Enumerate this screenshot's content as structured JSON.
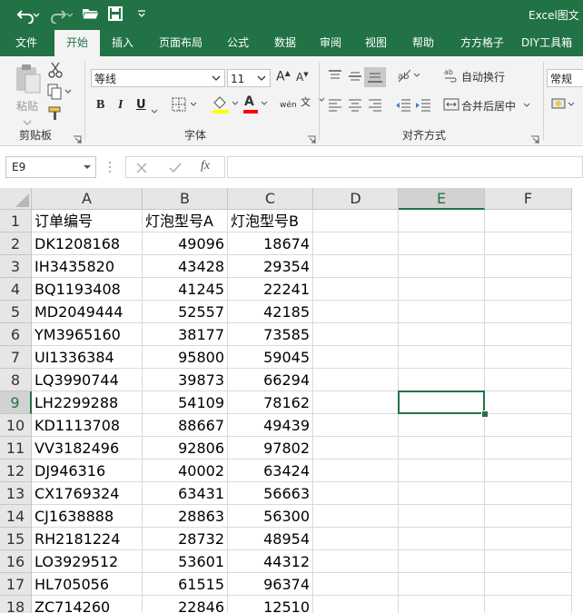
{
  "window": {
    "title": "Excel图文"
  },
  "tabs": [
    {
      "label": "文件"
    },
    {
      "label": "开始"
    },
    {
      "label": "插入"
    },
    {
      "label": "页面布局"
    },
    {
      "label": "公式"
    },
    {
      "label": "数据"
    },
    {
      "label": "审阅"
    },
    {
      "label": "视图"
    },
    {
      "label": "帮助"
    },
    {
      "label": "方方格子"
    },
    {
      "label": "DIY工具箱"
    }
  ],
  "ribbon": {
    "clipboard": {
      "paste_label": "粘贴",
      "group_label": "剪贴板"
    },
    "font": {
      "name": "等线",
      "size": "11",
      "group_label": "字体",
      "bold": "B",
      "italic": "I",
      "underline": "U",
      "grow": "A",
      "shrink": "A",
      "font_color": "A",
      "phonetic": "wén"
    },
    "alignment": {
      "wrap_label": "自动换行",
      "merge_label": "合并后居中",
      "group_label": "对齐方式"
    },
    "number": {
      "format": "常规"
    }
  },
  "formula_bar": {
    "name_box": "E9",
    "formula": "",
    "fx": "fx"
  },
  "columns": [
    "A",
    "B",
    "C",
    "D",
    "E",
    "F"
  ],
  "rows": [
    "1",
    "2",
    "3",
    "4",
    "5",
    "6",
    "7",
    "8",
    "9",
    "10",
    "11",
    "12",
    "13",
    "14",
    "15",
    "16",
    "17",
    "18"
  ],
  "selected_cell": "E9",
  "cells": [
    [
      "订单编号",
      "灯泡型号A",
      "灯泡型号B"
    ],
    [
      "DK1208168",
      "49096",
      "18674"
    ],
    [
      "IH3435820",
      "43428",
      "29354"
    ],
    [
      "BQ1193408",
      "41245",
      "22241"
    ],
    [
      "MD2049444",
      "52557",
      "42185"
    ],
    [
      "YM3965160",
      "38177",
      "73585"
    ],
    [
      "UI1336384",
      "95800",
      "59045"
    ],
    [
      "LQ3990744",
      "39873",
      "66294"
    ],
    [
      "LH2299288",
      "54109",
      "78162"
    ],
    [
      "KD1113708",
      "88667",
      "49439"
    ],
    [
      "VV3182496",
      "92806",
      "97802"
    ],
    [
      "DJ946316",
      "40002",
      "63424"
    ],
    [
      "CX1769324",
      "63431",
      "56663"
    ],
    [
      "CJ1638888",
      "28863",
      "56300"
    ],
    [
      "RH2181224",
      "28732",
      "48954"
    ],
    [
      "LO3929512",
      "53601",
      "44312"
    ],
    [
      "HL705056",
      "61515",
      "96374"
    ],
    [
      "ZC714260",
      "22846",
      "12510"
    ]
  ],
  "colors": {
    "accent": "#217346",
    "header_bg": "#e6e6e6",
    "gridline": "#dadada"
  }
}
